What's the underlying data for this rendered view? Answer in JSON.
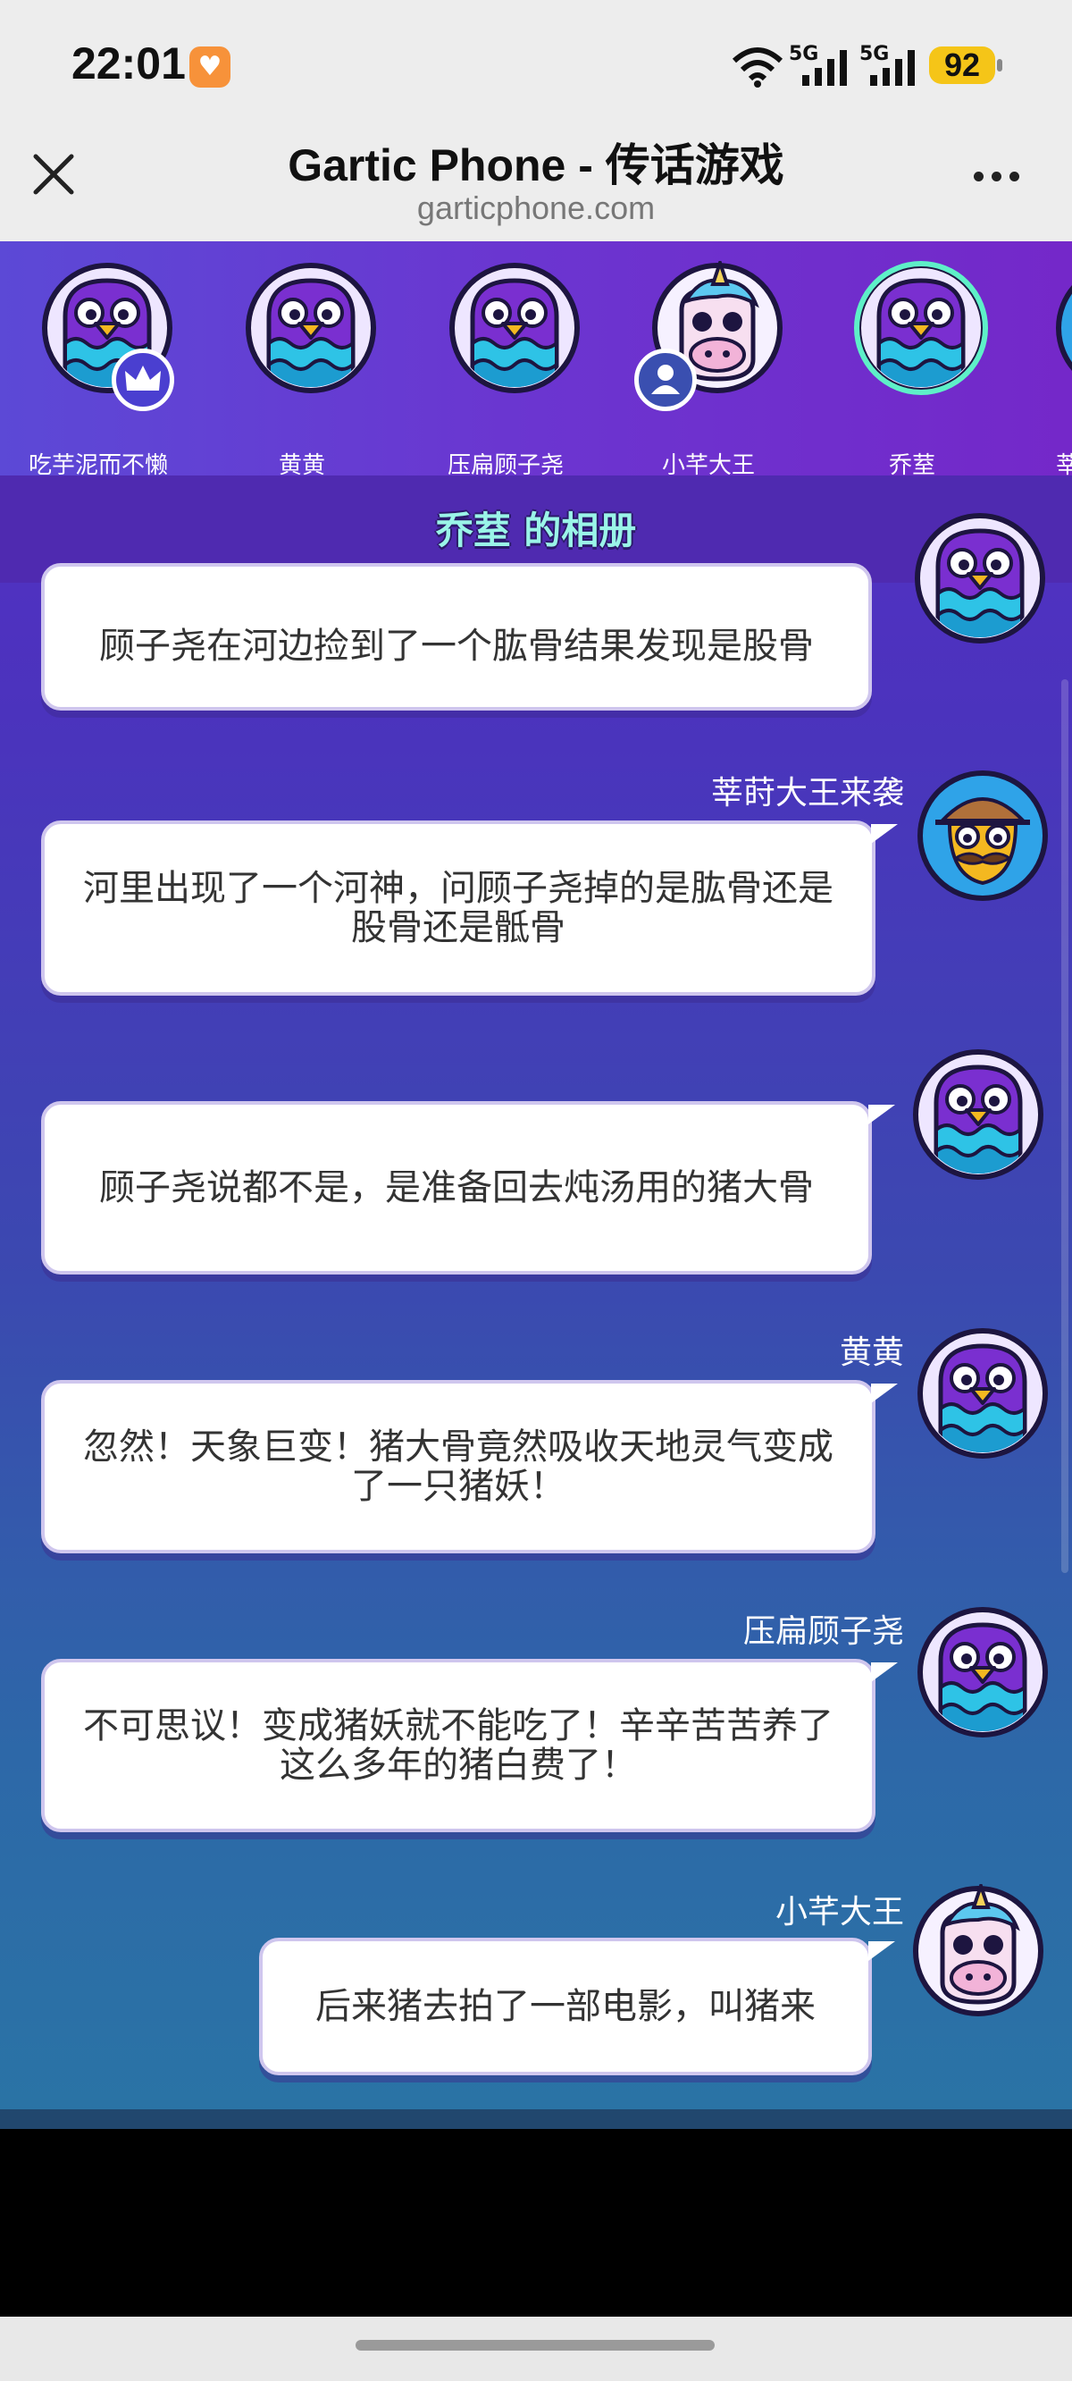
{
  "status_bar": {
    "time": "22:01",
    "net_label_1": "5G",
    "net_label_2": "5G",
    "battery": "92"
  },
  "header": {
    "title": "Gartic Phone - 传话游戏",
    "url": "garticphone.com"
  },
  "players": [
    {
      "name": "吃芋泥而不懒",
      "avatar": "purple-bird-avatar",
      "badge": "crown-icon"
    },
    {
      "name": "黄黄",
      "avatar": "purple-bird-avatar"
    },
    {
      "name": "压扁顾子尧",
      "avatar": "purple-bird-avatar"
    },
    {
      "name": "小芊大王",
      "avatar": "unicorn-avatar",
      "badge": "user-icon"
    },
    {
      "name": "乔荎",
      "avatar": "purple-bird-avatar",
      "selected": true
    },
    {
      "name": "莘",
      "avatar": "partial-avatar"
    }
  ],
  "album": {
    "title": "乔荎 的相册"
  },
  "messages": [
    {
      "sender": "",
      "text": "顾子尧在河边捡到了一个肱骨结果发现是股骨",
      "avatar": "purple-bird-avatar"
    },
    {
      "sender": "莘莳大王来袭",
      "text": "河里出现了一个河神，问顾子尧掉的是肱骨还是股骨还是骶骨",
      "avatar": "detective-duck-avatar"
    },
    {
      "sender": "",
      "text": "顾子尧说都不是，是准备回去炖汤用的猪大骨",
      "avatar": "purple-bird-avatar"
    },
    {
      "sender": "黄黄",
      "text": "忽然！天象巨变！猪大骨竟然吸收天地灵气变成了一只猪妖！",
      "avatar": "purple-bird-avatar"
    },
    {
      "sender": "压扁顾子尧",
      "text": "不可思议！变成猪妖就不能吃了！辛辛苦苦养了这么多年的猪白费了！",
      "avatar": "purple-bird-avatar"
    },
    {
      "sender": "小芊大王",
      "text": "后来猪去拍了一部电影，叫猪来",
      "avatar": "unicorn-avatar"
    }
  ],
  "colors": {
    "accent_title": "#9af5e8",
    "selected_ring": "#5ef0c8",
    "bird_body": "#7a2fd0",
    "bird_waves": "#2ec3e6",
    "beak": "#f4b820"
  }
}
